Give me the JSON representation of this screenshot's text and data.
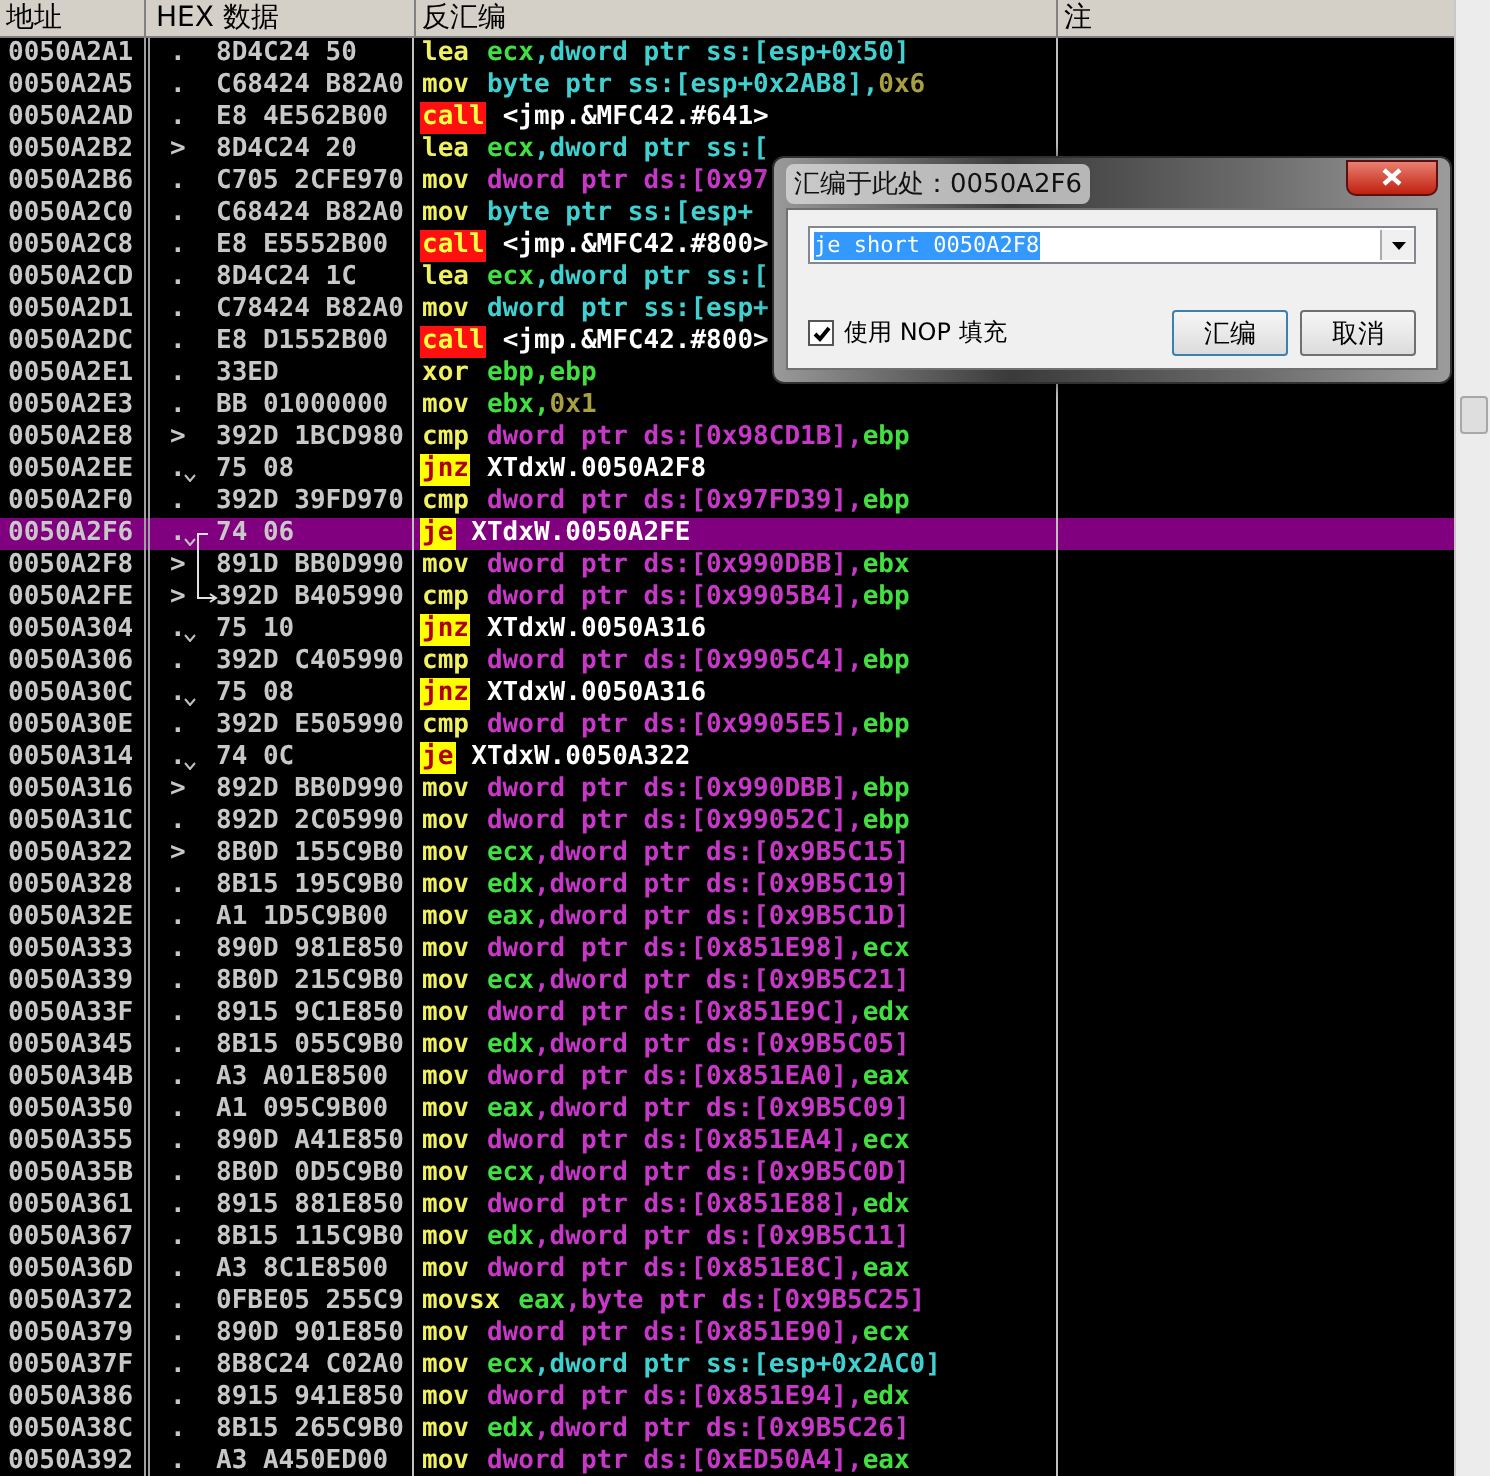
{
  "columns": [
    "地址",
    "HEX 数据",
    "反汇编",
    "注"
  ],
  "rows": [
    {
      "address": "0050A2A1",
      "marker": ".",
      "jump": false,
      "hex": "8D4C24 50",
      "mnemonic": "lea",
      "kind": "plain",
      "operands": [
        {
          "text": "ecx",
          "kind": "reg"
        },
        {
          "text": ",dword ptr ss:[esp+0x50]",
          "kind": "ss"
        }
      ],
      "selected": false,
      "branch_start": false,
      "branch_end": false
    },
    {
      "address": "0050A2A5",
      "marker": ".",
      "jump": false,
      "hex": "C68424 B82A0",
      "mnemonic": "mov",
      "kind": "plain",
      "operands": [
        {
          "text": "byte ptr ss:[esp+0x2AB8],",
          "kind": "ss"
        },
        {
          "text": "0x6",
          "kind": "imm"
        }
      ],
      "selected": false,
      "branch_start": false,
      "branch_end": false
    },
    {
      "address": "0050A2AD",
      "marker": ".",
      "jump": false,
      "hex": "E8 4E562B00",
      "mnemonic": "call",
      "kind": "call",
      "operands": [
        {
          "text": "<jmp.&MFC42.#641>",
          "kind": "label"
        }
      ],
      "selected": false,
      "branch_start": false,
      "branch_end": false
    },
    {
      "address": "0050A2B2",
      "marker": ">",
      "jump": false,
      "hex": "8D4C24 20",
      "mnemonic": "lea",
      "kind": "plain",
      "operands": [
        {
          "text": "ecx",
          "kind": "reg"
        },
        {
          "text": ",dword ptr ss:[",
          "kind": "ss"
        }
      ],
      "selected": false,
      "branch_start": false,
      "branch_end": false
    },
    {
      "address": "0050A2B6",
      "marker": ".",
      "jump": false,
      "hex": "C705 2CFE970",
      "mnemonic": "mov",
      "kind": "plain",
      "operands": [
        {
          "text": "dword ptr ds:[0x97",
          "kind": "ds"
        }
      ],
      "selected": false,
      "branch_start": false,
      "branch_end": false
    },
    {
      "address": "0050A2C0",
      "marker": ".",
      "jump": false,
      "hex": "C68424 B82A0",
      "mnemonic": "mov",
      "kind": "plain",
      "operands": [
        {
          "text": "byte ptr ss:[esp+",
          "kind": "ss"
        }
      ],
      "selected": false,
      "branch_start": false,
      "branch_end": false
    },
    {
      "address": "0050A2C8",
      "marker": ".",
      "jump": false,
      "hex": "E8 E5552B00",
      "mnemonic": "call",
      "kind": "call",
      "operands": [
        {
          "text": "<jmp.&MFC42.#800>",
          "kind": "label"
        }
      ],
      "selected": false,
      "branch_start": false,
      "branch_end": false
    },
    {
      "address": "0050A2CD",
      "marker": ".",
      "jump": false,
      "hex": "8D4C24 1C",
      "mnemonic": "lea",
      "kind": "plain",
      "operands": [
        {
          "text": "ecx",
          "kind": "reg"
        },
        {
          "text": ",dword ptr ss:[",
          "kind": "ss"
        }
      ],
      "selected": false,
      "branch_start": false,
      "branch_end": false
    },
    {
      "address": "0050A2D1",
      "marker": ".",
      "jump": false,
      "hex": "C78424 B82A0",
      "mnemonic": "mov",
      "kind": "plain",
      "operands": [
        {
          "text": "dword ptr ss:[esp+",
          "kind": "ss"
        }
      ],
      "selected": false,
      "branch_start": false,
      "branch_end": false
    },
    {
      "address": "0050A2DC",
      "marker": ".",
      "jump": false,
      "hex": "E8 D1552B00",
      "mnemonic": "call",
      "kind": "call",
      "operands": [
        {
          "text": "<jmp.&MFC42.#800>",
          "kind": "label"
        }
      ],
      "selected": false,
      "branch_start": false,
      "branch_end": false
    },
    {
      "address": "0050A2E1",
      "marker": ".",
      "jump": false,
      "hex": "33ED",
      "mnemonic": "xor",
      "kind": "plain",
      "operands": [
        {
          "text": "ebp,ebp",
          "kind": "reg"
        }
      ],
      "selected": false,
      "branch_start": false,
      "branch_end": false
    },
    {
      "address": "0050A2E3",
      "marker": ".",
      "jump": false,
      "hex": "BB 01000000",
      "mnemonic": "mov",
      "kind": "plain",
      "operands": [
        {
          "text": "ebx,",
          "kind": "reg"
        },
        {
          "text": "0x1",
          "kind": "imm"
        }
      ],
      "selected": false,
      "branch_start": false,
      "branch_end": false
    },
    {
      "address": "0050A2E8",
      "marker": ">",
      "jump": false,
      "hex": "392D 1BCD980",
      "mnemonic": "cmp",
      "kind": "plain",
      "operands": [
        {
          "text": "dword ptr ds:[0x98CD1B],",
          "kind": "ds"
        },
        {
          "text": "ebp",
          "kind": "reg"
        }
      ],
      "selected": false,
      "branch_start": false,
      "branch_end": false
    },
    {
      "address": "0050A2EE",
      "marker": ".",
      "jump": true,
      "hex": "75 08",
      "mnemonic": "jnz",
      "kind": "jump",
      "operands": [
        {
          "text": "XTdxW.0050A2F8",
          "kind": "label"
        }
      ],
      "selected": false,
      "branch_start": false,
      "branch_end": false
    },
    {
      "address": "0050A2F0",
      "marker": ".",
      "jump": false,
      "hex": "392D 39FD970",
      "mnemonic": "cmp",
      "kind": "plain",
      "operands": [
        {
          "text": "dword ptr ds:[0x97FD39],",
          "kind": "ds"
        },
        {
          "text": "ebp",
          "kind": "reg"
        }
      ],
      "selected": false,
      "branch_start": false,
      "branch_end": false
    },
    {
      "address": "0050A2F6",
      "marker": ".",
      "jump": true,
      "hex": "74 06",
      "mnemonic": "je",
      "kind": "jump",
      "operands": [
        {
          "text": "XTdxW.0050A2FE",
          "kind": "label"
        }
      ],
      "selected": true,
      "branch_start": true,
      "branch_end": false
    },
    {
      "address": "0050A2F8",
      "marker": ">",
      "jump": false,
      "hex": "891D BB0D990",
      "mnemonic": "mov",
      "kind": "plain",
      "operands": [
        {
          "text": "dword ptr ds:[0x990DBB],",
          "kind": "ds"
        },
        {
          "text": "ebx",
          "kind": "reg"
        }
      ],
      "selected": false,
      "branch_start": false,
      "branch_end": false
    },
    {
      "address": "0050A2FE",
      "marker": ">",
      "jump": false,
      "hex": "392D B405990",
      "mnemonic": "cmp",
      "kind": "plain",
      "operands": [
        {
          "text": "dword ptr ds:[0x9905B4],",
          "kind": "ds"
        },
        {
          "text": "ebp",
          "kind": "reg"
        }
      ],
      "selected": false,
      "branch_start": false,
      "branch_end": true
    },
    {
      "address": "0050A304",
      "marker": ".",
      "jump": true,
      "hex": "75 10",
      "mnemonic": "jnz",
      "kind": "jump",
      "operands": [
        {
          "text": "XTdxW.0050A316",
          "kind": "label"
        }
      ],
      "selected": false,
      "branch_start": false,
      "branch_end": false
    },
    {
      "address": "0050A306",
      "marker": ".",
      "jump": false,
      "hex": "392D C405990",
      "mnemonic": "cmp",
      "kind": "plain",
      "operands": [
        {
          "text": "dword ptr ds:[0x9905C4],",
          "kind": "ds"
        },
        {
          "text": "ebp",
          "kind": "reg"
        }
      ],
      "selected": false,
      "branch_start": false,
      "branch_end": false
    },
    {
      "address": "0050A30C",
      "marker": ".",
      "jump": true,
      "hex": "75 08",
      "mnemonic": "jnz",
      "kind": "jump",
      "operands": [
        {
          "text": "XTdxW.0050A316",
          "kind": "label"
        }
      ],
      "selected": false,
      "branch_start": false,
      "branch_end": false
    },
    {
      "address": "0050A30E",
      "marker": ".",
      "jump": false,
      "hex": "392D E505990",
      "mnemonic": "cmp",
      "kind": "plain",
      "operands": [
        {
          "text": "dword ptr ds:[0x9905E5],",
          "kind": "ds"
        },
        {
          "text": "ebp",
          "kind": "reg"
        }
      ],
      "selected": false,
      "branch_start": false,
      "branch_end": false
    },
    {
      "address": "0050A314",
      "marker": ".",
      "jump": true,
      "hex": "74 0C",
      "mnemonic": "je",
      "kind": "jump",
      "operands": [
        {
          "text": "XTdxW.0050A322",
          "kind": "label"
        }
      ],
      "selected": false,
      "branch_start": false,
      "branch_end": false
    },
    {
      "address": "0050A316",
      "marker": ">",
      "jump": false,
      "hex": "892D BB0D990",
      "mnemonic": "mov",
      "kind": "plain",
      "operands": [
        {
          "text": "dword ptr ds:[0x990DBB],",
          "kind": "ds"
        },
        {
          "text": "ebp",
          "kind": "reg"
        }
      ],
      "selected": false,
      "branch_start": false,
      "branch_end": false
    },
    {
      "address": "0050A31C",
      "marker": ".",
      "jump": false,
      "hex": "892D 2C05990",
      "mnemonic": "mov",
      "kind": "plain",
      "operands": [
        {
          "text": "dword ptr ds:[0x99052C],",
          "kind": "ds"
        },
        {
          "text": "ebp",
          "kind": "reg"
        }
      ],
      "selected": false,
      "branch_start": false,
      "branch_end": false
    },
    {
      "address": "0050A322",
      "marker": ">",
      "jump": false,
      "hex": "8B0D 155C9B0",
      "mnemonic": "mov",
      "kind": "plain",
      "operands": [
        {
          "text": "ecx",
          "kind": "reg"
        },
        {
          "text": ",dword ptr ds:[0x9B5C15]",
          "kind": "ds"
        }
      ],
      "selected": false,
      "branch_start": false,
      "branch_end": false
    },
    {
      "address": "0050A328",
      "marker": ".",
      "jump": false,
      "hex": "8B15 195C9B0",
      "mnemonic": "mov",
      "kind": "plain",
      "operands": [
        {
          "text": "edx",
          "kind": "reg"
        },
        {
          "text": ",dword ptr ds:[0x9B5C19]",
          "kind": "ds"
        }
      ],
      "selected": false,
      "branch_start": false,
      "branch_end": false
    },
    {
      "address": "0050A32E",
      "marker": ".",
      "jump": false,
      "hex": "A1 1D5C9B00",
      "mnemonic": "mov",
      "kind": "plain",
      "operands": [
        {
          "text": "eax",
          "kind": "reg"
        },
        {
          "text": ",dword ptr ds:[0x9B5C1D]",
          "kind": "ds"
        }
      ],
      "selected": false,
      "branch_start": false,
      "branch_end": false
    },
    {
      "address": "0050A333",
      "marker": ".",
      "jump": false,
      "hex": "890D 981E850",
      "mnemonic": "mov",
      "kind": "plain",
      "operands": [
        {
          "text": "dword ptr ds:[0x851E98],",
          "kind": "ds"
        },
        {
          "text": "ecx",
          "kind": "reg"
        }
      ],
      "selected": false,
      "branch_start": false,
      "branch_end": false
    },
    {
      "address": "0050A339",
      "marker": ".",
      "jump": false,
      "hex": "8B0D 215C9B0",
      "mnemonic": "mov",
      "kind": "plain",
      "operands": [
        {
          "text": "ecx",
          "kind": "reg"
        },
        {
          "text": ",dword ptr ds:[0x9B5C21]",
          "kind": "ds"
        }
      ],
      "selected": false,
      "branch_start": false,
      "branch_end": false
    },
    {
      "address": "0050A33F",
      "marker": ".",
      "jump": false,
      "hex": "8915 9C1E850",
      "mnemonic": "mov",
      "kind": "plain",
      "operands": [
        {
          "text": "dword ptr ds:[0x851E9C],",
          "kind": "ds"
        },
        {
          "text": "edx",
          "kind": "reg"
        }
      ],
      "selected": false,
      "branch_start": false,
      "branch_end": false
    },
    {
      "address": "0050A345",
      "marker": ".",
      "jump": false,
      "hex": "8B15 055C9B0",
      "mnemonic": "mov",
      "kind": "plain",
      "operands": [
        {
          "text": "edx",
          "kind": "reg"
        },
        {
          "text": ",dword ptr ds:[0x9B5C05]",
          "kind": "ds"
        }
      ],
      "selected": false,
      "branch_start": false,
      "branch_end": false
    },
    {
      "address": "0050A34B",
      "marker": ".",
      "jump": false,
      "hex": "A3 A01E8500",
      "mnemonic": "mov",
      "kind": "plain",
      "operands": [
        {
          "text": "dword ptr ds:[0x851EA0],",
          "kind": "ds"
        },
        {
          "text": "eax",
          "kind": "reg"
        }
      ],
      "selected": false,
      "branch_start": false,
      "branch_end": false
    },
    {
      "address": "0050A350",
      "marker": ".",
      "jump": false,
      "hex": "A1 095C9B00",
      "mnemonic": "mov",
      "kind": "plain",
      "operands": [
        {
          "text": "eax",
          "kind": "reg"
        },
        {
          "text": ",dword ptr ds:[0x9B5C09]",
          "kind": "ds"
        }
      ],
      "selected": false,
      "branch_start": false,
      "branch_end": false
    },
    {
      "address": "0050A355",
      "marker": ".",
      "jump": false,
      "hex": "890D A41E850",
      "mnemonic": "mov",
      "kind": "plain",
      "operands": [
        {
          "text": "dword ptr ds:[0x851EA4],",
          "kind": "ds"
        },
        {
          "text": "ecx",
          "kind": "reg"
        }
      ],
      "selected": false,
      "branch_start": false,
      "branch_end": false
    },
    {
      "address": "0050A35B",
      "marker": ".",
      "jump": false,
      "hex": "8B0D 0D5C9B0",
      "mnemonic": "mov",
      "kind": "plain",
      "operands": [
        {
          "text": "ecx",
          "kind": "reg"
        },
        {
          "text": ",dword ptr ds:[0x9B5C0D]",
          "kind": "ds"
        }
      ],
      "selected": false,
      "branch_start": false,
      "branch_end": false
    },
    {
      "address": "0050A361",
      "marker": ".",
      "jump": false,
      "hex": "8915 881E850",
      "mnemonic": "mov",
      "kind": "plain",
      "operands": [
        {
          "text": "dword ptr ds:[0x851E88],",
          "kind": "ds"
        },
        {
          "text": "edx",
          "kind": "reg"
        }
      ],
      "selected": false,
      "branch_start": false,
      "branch_end": false
    },
    {
      "address": "0050A367",
      "marker": ".",
      "jump": false,
      "hex": "8B15 115C9B0",
      "mnemonic": "mov",
      "kind": "plain",
      "operands": [
        {
          "text": "edx",
          "kind": "reg"
        },
        {
          "text": ",dword ptr ds:[0x9B5C11]",
          "kind": "ds"
        }
      ],
      "selected": false,
      "branch_start": false,
      "branch_end": false
    },
    {
      "address": "0050A36D",
      "marker": ".",
      "jump": false,
      "hex": "A3 8C1E8500",
      "mnemonic": "mov",
      "kind": "plain",
      "operands": [
        {
          "text": "dword ptr ds:[0x851E8C],",
          "kind": "ds"
        },
        {
          "text": "eax",
          "kind": "reg"
        }
      ],
      "selected": false,
      "branch_start": false,
      "branch_end": false
    },
    {
      "address": "0050A372",
      "marker": ".",
      "jump": false,
      "hex": "0FBE05 255C9",
      "mnemonic": "movsx",
      "kind": "plain",
      "operands": [
        {
          "text": "eax",
          "kind": "reg"
        },
        {
          "text": ",byte ptr ds:[0x9B5C25]",
          "kind": "ds"
        }
      ],
      "selected": false,
      "branch_start": false,
      "branch_end": false
    },
    {
      "address": "0050A379",
      "marker": ".",
      "jump": false,
      "hex": "890D 901E850",
      "mnemonic": "mov",
      "kind": "plain",
      "operands": [
        {
          "text": "dword ptr ds:[0x851E90],",
          "kind": "ds"
        },
        {
          "text": "ecx",
          "kind": "reg"
        }
      ],
      "selected": false,
      "branch_start": false,
      "branch_end": false
    },
    {
      "address": "0050A37F",
      "marker": ".",
      "jump": false,
      "hex": "8B8C24 C02A0",
      "mnemonic": "mov",
      "kind": "plain",
      "operands": [
        {
          "text": "ecx",
          "kind": "reg"
        },
        {
          "text": ",dword ptr ss:[esp+0x2AC0]",
          "kind": "ss"
        }
      ],
      "selected": false,
      "branch_start": false,
      "branch_end": false
    },
    {
      "address": "0050A386",
      "marker": ".",
      "jump": false,
      "hex": "8915 941E850",
      "mnemonic": "mov",
      "kind": "plain",
      "operands": [
        {
          "text": "dword ptr ds:[0x851E94],",
          "kind": "ds"
        },
        {
          "text": "edx",
          "kind": "reg"
        }
      ],
      "selected": false,
      "branch_start": false,
      "branch_end": false
    },
    {
      "address": "0050A38C",
      "marker": ".",
      "jump": false,
      "hex": "8B15 265C9B0",
      "mnemonic": "mov",
      "kind": "plain",
      "operands": [
        {
          "text": "edx",
          "kind": "reg"
        },
        {
          "text": ",dword ptr ds:[0x9B5C26]",
          "kind": "ds"
        }
      ],
      "selected": false,
      "branch_start": false,
      "branch_end": false
    },
    {
      "address": "0050A392",
      "marker": ".",
      "jump": false,
      "hex": "A3 A450ED00",
      "mnemonic": "mov",
      "kind": "plain",
      "operands": [
        {
          "text": "dword ptr ds:[0xED50A4],",
          "kind": "ds"
        },
        {
          "text": "eax",
          "kind": "reg"
        }
      ],
      "selected": false,
      "branch_start": false,
      "branch_end": false
    }
  ],
  "dialog": {
    "title": "汇编于此处：0050A2F6",
    "input": {
      "value": "je short 0050A2F8"
    },
    "nop_fill": {
      "label": "使用 NOP 填充",
      "checked": true
    },
    "buttons": [
      "汇编",
      "取消"
    ]
  }
}
